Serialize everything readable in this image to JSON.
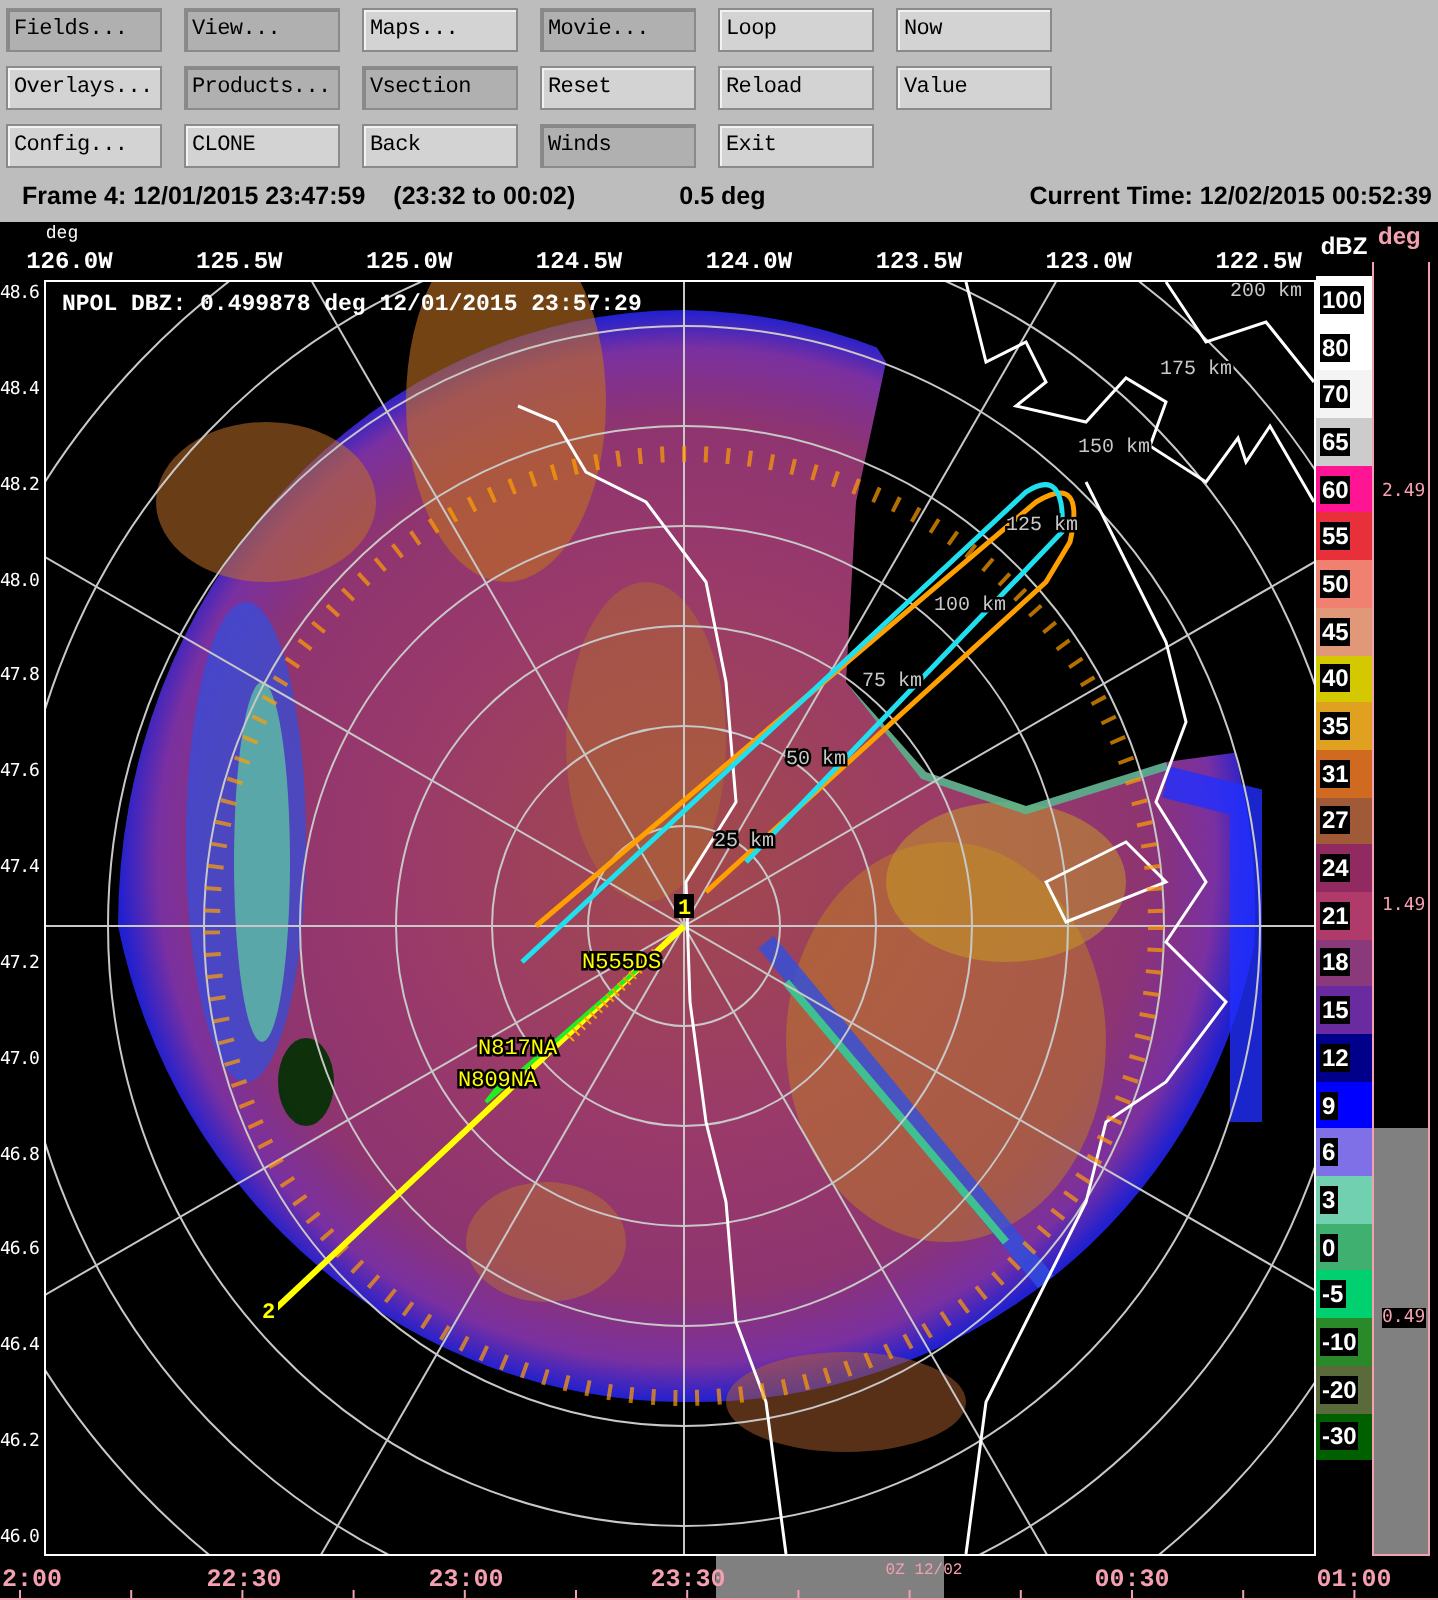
{
  "toolbar": {
    "buttons": [
      {
        "label": "Fields...",
        "active": true
      },
      {
        "label": "View...",
        "active": true
      },
      {
        "label": "Maps...",
        "active": false
      },
      {
        "label": "Movie...",
        "active": true
      },
      {
        "label": "Loop",
        "active": false
      },
      {
        "label": "Now",
        "active": false
      },
      {
        "label": "Overlays...",
        "active": false
      },
      {
        "label": "Products...",
        "active": true
      },
      {
        "label": "Vsection",
        "active": true
      },
      {
        "label": "Reset",
        "active": false
      },
      {
        "label": "Reload",
        "active": false
      },
      {
        "label": "Value",
        "active": false
      },
      {
        "label": "Config...",
        "active": false
      },
      {
        "label": "CLONE",
        "active": false
      },
      {
        "label": "Back",
        "active": false
      },
      {
        "label": "Winds",
        "active": true
      },
      {
        "label": "Exit",
        "active": false
      }
    ]
  },
  "status": {
    "frame": "Frame 4: 12/01/2015 23:47:59",
    "range": "(23:32 to 00:02)",
    "elevation": "0.5 deg",
    "current_time": "Current Time: 12/02/2015 00:52:39"
  },
  "plot": {
    "title": "NPOL DBZ: 0.499878 deg 12/01/2015 23:57:29",
    "axis_unit": "deg",
    "lon_labels": [
      "126.0W",
      "125.5W",
      "125.0W",
      "124.5W",
      "124.0W",
      "123.5W",
      "123.0W",
      "122.5W"
    ],
    "lat_labels": [
      "48.6",
      "48.4",
      "48.2",
      "48.0",
      "47.8",
      "47.6",
      "47.4",
      "47.2",
      "47.0",
      "46.8",
      "46.6",
      "46.4",
      "46.2",
      "46.0"
    ],
    "range_labels": [
      "200 km",
      "175 km",
      "150 km",
      "125 km",
      "100 km",
      "75 km",
      "50 km",
      "25 km"
    ],
    "aircraft_labels": [
      "N555DS",
      "N817NA",
      "N809NA"
    ],
    "waypoint_labels": [
      "1",
      "2"
    ]
  },
  "color_scale": {
    "unit": "dBZ",
    "entries": [
      {
        "value": "100",
        "color": "#ffffff"
      },
      {
        "value": "80",
        "color": "#ffffff"
      },
      {
        "value": "70",
        "color": "#f4f4f4"
      },
      {
        "value": "65",
        "color": "#cccccc"
      },
      {
        "value": "60",
        "color": "#ff1493"
      },
      {
        "value": "55",
        "color": "#e8303a"
      },
      {
        "value": "50",
        "color": "#f08070"
      },
      {
        "value": "45",
        "color": "#e09878"
      },
      {
        "value": "40",
        "color": "#d4c800"
      },
      {
        "value": "35",
        "color": "#e0a020"
      },
      {
        "value": "31",
        "color": "#d06a20"
      },
      {
        "value": "27",
        "color": "#a05a38"
      },
      {
        "value": "24",
        "color": "#902a60"
      },
      {
        "value": "21",
        "color": "#b03a6a"
      },
      {
        "value": "18",
        "color": "#8a3a7a"
      },
      {
        "value": "15",
        "color": "#6a2aa0"
      },
      {
        "value": "12",
        "color": "#00008a"
      },
      {
        "value": "9",
        "color": "#0000ff"
      },
      {
        "value": "6",
        "color": "#8070e8"
      },
      {
        "value": "3",
        "color": "#70d0b0"
      },
      {
        "value": "0",
        "color": "#40b070"
      },
      {
        "value": "-5",
        "color": "#00d070"
      },
      {
        "value": "-10",
        "color": "#2a8a2a"
      },
      {
        "value": "-20",
        "color": "#5a6a3a"
      },
      {
        "value": "-30",
        "color": "#006000"
      }
    ]
  },
  "elevation_bar": {
    "unit": "deg",
    "labels": [
      "2.49",
      "1.49",
      "0.49"
    ],
    "level": 0.33
  },
  "time_axis": {
    "labels": [
      "2:00",
      "22:30",
      "23:00",
      "23:30",
      "00:30",
      "01:00"
    ],
    "date_label": "0Z 12/02"
  }
}
